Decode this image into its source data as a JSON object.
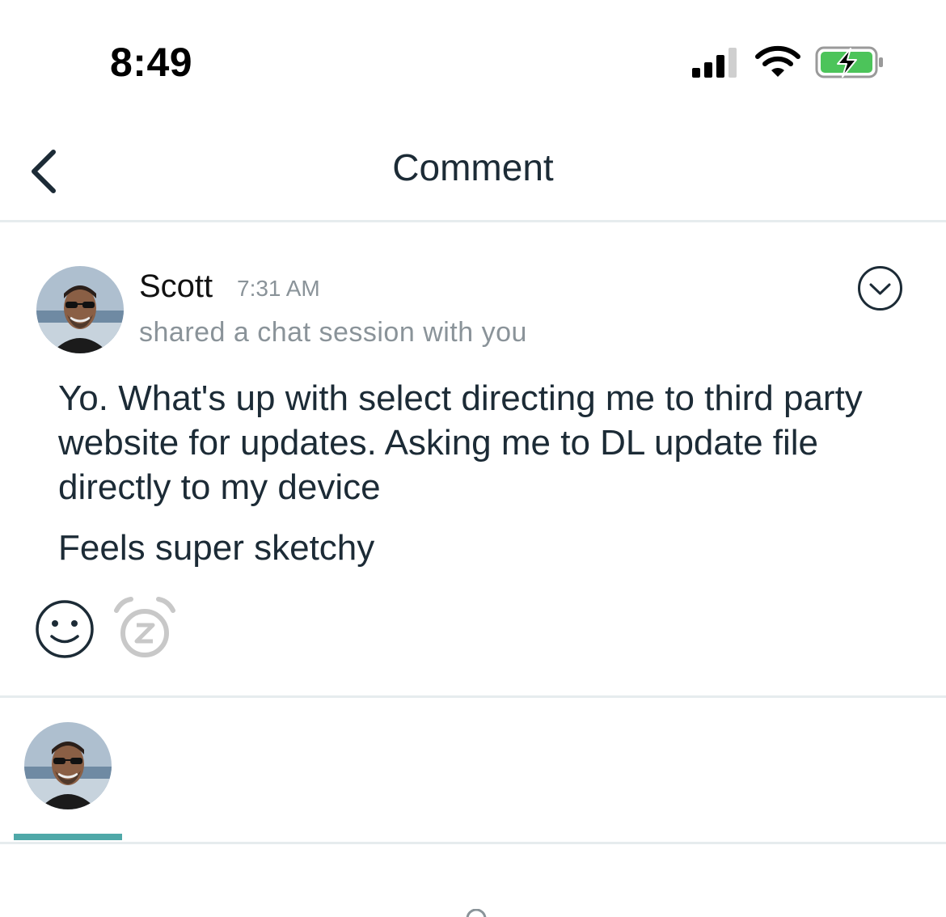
{
  "status_bar": {
    "time": "8:49",
    "icons": [
      "cellular-signal-icon",
      "wifi-icon",
      "battery-charging-icon"
    ],
    "battery_color": "#4cc45a"
  },
  "nav": {
    "title": "Comment",
    "back_icon": "chevron-left-icon"
  },
  "comment": {
    "author": "Scott",
    "time": "7:31 AM",
    "subtitle": "shared a chat session with you",
    "message_lines": [
      "Yo.  What's up with select directing me to third party website for updates.  Asking me to DL update file directly to my device",
      "Feels super sketchy"
    ],
    "menu_icon": "chevron-down-circle-icon",
    "reactions": [
      "smile-icon",
      "snooze-alarm-icon"
    ]
  },
  "reply": {
    "active_tab_color": "#4fa8a8"
  },
  "colors": {
    "text": "#1c2b36",
    "muted": "#8a9399",
    "divider": "#e6ecee"
  }
}
